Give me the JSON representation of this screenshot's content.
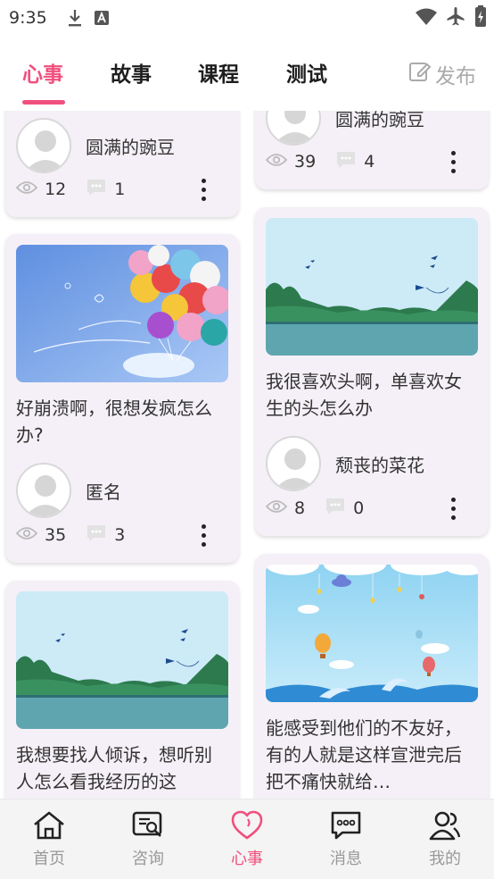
{
  "status_bar": {
    "time": "9:35"
  },
  "tabs": [
    {
      "label": "心事",
      "active": true
    },
    {
      "label": "故事",
      "active": false
    },
    {
      "label": "课程",
      "active": false
    },
    {
      "label": "测试",
      "active": false
    }
  ],
  "publish_label": "发布",
  "accent_color": "#f0507e",
  "posts": {
    "p1": {
      "author": "圆满的豌豆",
      "views": "12",
      "comments": "1"
    },
    "p2": {
      "author": "圆满的豌豆",
      "views": "39",
      "comments": "4"
    },
    "p3": {
      "image": "balloons-illustration",
      "title": "好崩溃啊，很想发疯怎么办?",
      "author": "匿名",
      "views": "35",
      "comments": "3"
    },
    "p4": {
      "image": "seaside-landscape-illustration",
      "title": "我很喜欢头啊，单喜欢女生的头怎么办",
      "author": "颓丧的菜花",
      "views": "8",
      "comments": "0"
    },
    "p5": {
      "image": "seaside-landscape-illustration",
      "title": "我想要找人倾诉，想听别人怎么看我经历的这"
    },
    "p6": {
      "image": "sky-balloons-illustration",
      "title": "能感受到他们的不友好，有的人就是这样宣泄完后把不痛快就给…"
    }
  },
  "bottom_nav": [
    {
      "label": "首页",
      "icon": "home-icon",
      "active": false
    },
    {
      "label": "咨询",
      "icon": "consult-icon",
      "active": false
    },
    {
      "label": "心事",
      "icon": "heart-icon",
      "active": true
    },
    {
      "label": "消息",
      "icon": "message-icon",
      "active": false
    },
    {
      "label": "我的",
      "icon": "profile-icon",
      "active": false
    }
  ]
}
